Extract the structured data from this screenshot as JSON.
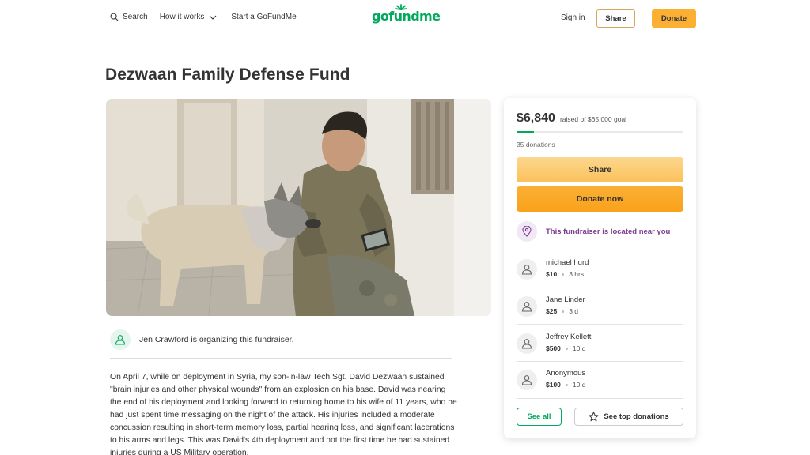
{
  "header": {
    "search_label": "Search",
    "how_label": "How it works",
    "start_label": "Start a GoFundMe",
    "logo_text": "gofundme",
    "signin_label": "Sign in",
    "share_label": "Share",
    "donate_label": "Donate"
  },
  "page": {
    "title": "Dezwaan Family Defense Fund"
  },
  "organizer": {
    "text": "Jen Crawford is organizing this fundraiser."
  },
  "story": {
    "text": "On April 7, while on deployment in Syria, my son-in-law Tech Sgt. David Dezwaan sustained \"brain injuries and other physical wounds\" from an explosion on his base. David was nearing the end of his deployment and looking forward to returning home to his wife of 11 years, who he had just spent time messaging on the night of the attack. His injuries included a moderate concussion resulting in short-term memory loss, partial hearing loss, and significant lacerations to his arms and legs. This was David's 4th deployment and not the first time he had sustained injuries during a US Military operation."
  },
  "card": {
    "amount": "$6,840",
    "goal_text": "raised of $65,000 goal",
    "progress_fraction": 0.105,
    "donations_count": "35 donations",
    "share_label": "Share",
    "donate_now_label": "Donate now",
    "location_text": "This fundraiser is located near you",
    "donors": [
      {
        "name": "michael hurd",
        "amount": "$10",
        "time": "3 hrs"
      },
      {
        "name": "Jane Linder",
        "amount": "$25",
        "time": "3 d"
      },
      {
        "name": "Jeffrey Kellett",
        "amount": "$500",
        "time": "10 d"
      },
      {
        "name": "Anonymous",
        "amount": "$100",
        "time": "10 d"
      }
    ],
    "see_all_label": "See all",
    "see_top_label": "See top donations"
  },
  "colors": {
    "brand_green": "#02a95c",
    "donate_orange": "#fbb034",
    "location_purple": "#7a3d8f"
  },
  "icons": [
    "search-icon",
    "chevron-down-icon",
    "user-icon",
    "location-pin-icon",
    "star-icon"
  ]
}
